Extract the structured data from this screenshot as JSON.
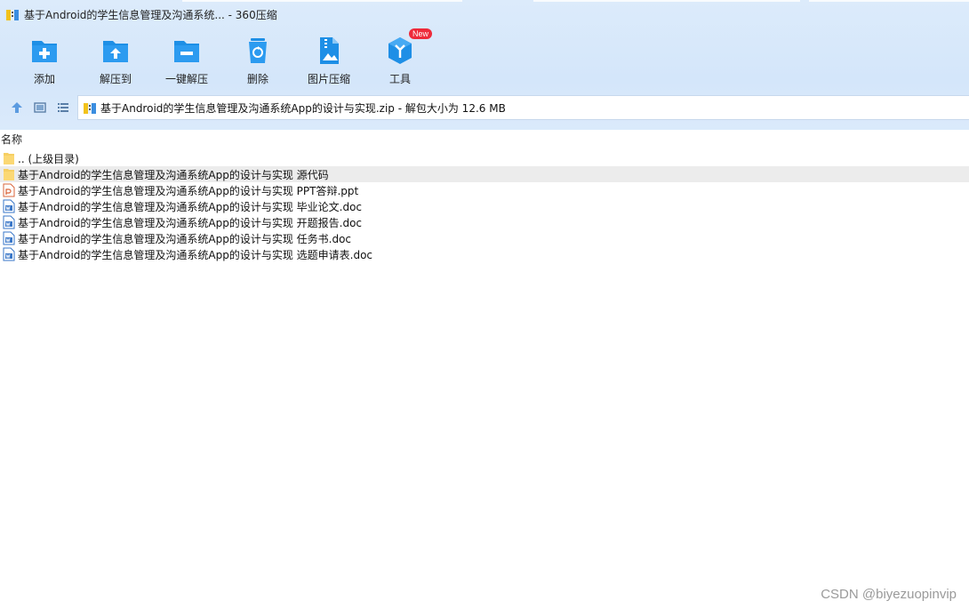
{
  "window": {
    "title": "基于Android的学生信息管理及沟通系统... - 360压缩"
  },
  "toolbar": {
    "items": [
      {
        "label": "添加",
        "icon": "add-folder-icon"
      },
      {
        "label": "解压到",
        "icon": "extract-to-icon"
      },
      {
        "label": "一键解压",
        "icon": "one-click-extract-icon"
      },
      {
        "label": "删除",
        "icon": "recycle-bin-icon"
      },
      {
        "label": "图片压缩",
        "icon": "image-compress-icon"
      },
      {
        "label": "工具",
        "icon": "tools-cube-icon",
        "badge": "New"
      }
    ]
  },
  "nav": {
    "up_icon": "up-arrow-icon",
    "thumbnail_icon": "thumbnail-view-icon",
    "list_icon": "list-view-icon"
  },
  "address": {
    "text": "基于Android的学生信息管理及沟通系统App的设计与实现.zip - 解包大小为 12.6 MB"
  },
  "columns": {
    "name": "名称"
  },
  "files": [
    {
      "name": ".. (上级目录)",
      "type": "folder",
      "highlight": false
    },
    {
      "name": "基于Android的学生信息管理及沟通系统App的设计与实现 源代码",
      "type": "folder",
      "highlight": true
    },
    {
      "name": "基于Android的学生信息管理及沟通系统App的设计与实现 PPT答辩.ppt",
      "type": "ppt",
      "highlight": false
    },
    {
      "name": "基于Android的学生信息管理及沟通系统App的设计与实现 毕业论文.doc",
      "type": "doc",
      "highlight": false
    },
    {
      "name": "基于Android的学生信息管理及沟通系统App的设计与实现 开题报告.doc",
      "type": "doc",
      "highlight": false
    },
    {
      "name": "基于Android的学生信息管理及沟通系统App的设计与实现 任务书.doc",
      "type": "doc",
      "highlight": false
    },
    {
      "name": "基于Android的学生信息管理及沟通系统App的设计与实现 选题申请表.doc",
      "type": "doc",
      "highlight": false
    }
  ],
  "watermark": "CSDN @biyezuopinvip",
  "colors": {
    "accent": "#1e8fe6",
    "toolbar_bg": "#d6e7fa",
    "highlight_row": "#ececec",
    "badge": "#ee2a3a"
  }
}
